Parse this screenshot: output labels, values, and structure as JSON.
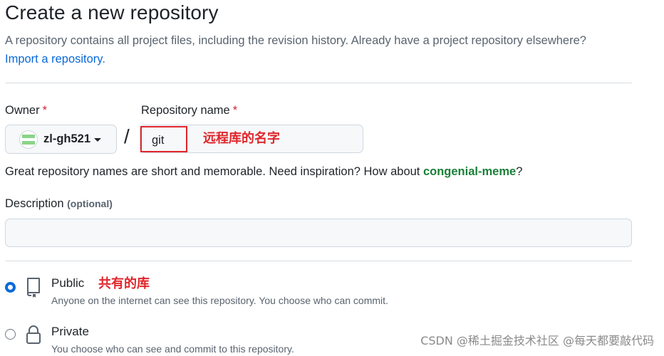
{
  "page": {
    "title": "Create a new repository",
    "subtitle": "A repository contains all project files, including the revision history. Already have a project repository elsewhere?",
    "import_link": "Import a repository."
  },
  "owner": {
    "label": "Owner",
    "required_mark": "*",
    "value": "zl-gh521"
  },
  "repository": {
    "label": "Repository name",
    "required_mark": "*",
    "value": "git",
    "separator": "/",
    "hint_text": "Great repository names are short and memorable. Need inspiration? How about ",
    "suggestion": "congenial-meme",
    "hint_end": "?"
  },
  "description": {
    "label": "Description",
    "optional": "(optional)",
    "value": ""
  },
  "visibility": {
    "options": [
      {
        "title": "Public",
        "desc": "Anyone on the internet can see this repository. You choose who can commit.",
        "checked": true,
        "icon": "repo-icon"
      },
      {
        "title": "Private",
        "desc": "You choose who can see and commit to this repository.",
        "checked": false,
        "icon": "lock-icon"
      }
    ]
  },
  "annotations": {
    "repo_name_note": "远程库的名字",
    "public_note": "共有的库"
  },
  "watermark": "CSDN @稀土掘金技术社区 @每天都要敲代码",
  "colors": {
    "accent": "#0969da",
    "required": "#d1242f",
    "suggestion": "#1a7f37",
    "annotation": "#e0262b"
  }
}
